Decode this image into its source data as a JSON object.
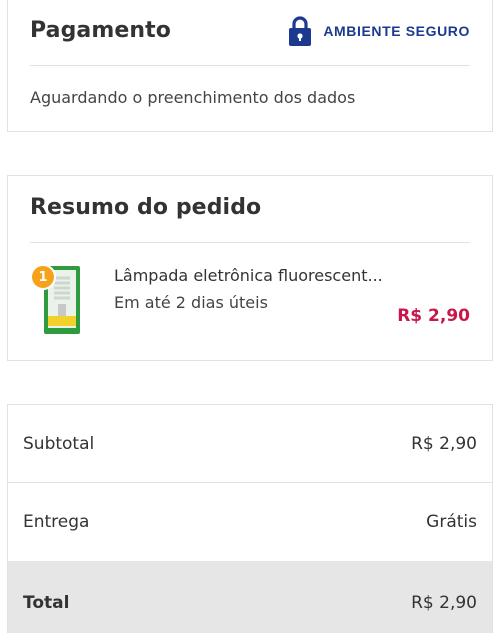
{
  "payment": {
    "title": "Pagamento",
    "secure_label": "AMBIENTE SEGURO",
    "status": "Aguardando o preenchimento dos dados"
  },
  "summary": {
    "title": "Resumo do pedido",
    "item": {
      "quantity": "1",
      "name": "Lâmpada eletrônica fluorescent...",
      "delivery": "Em até 2 dias úteis",
      "price": "R$ 2,90"
    }
  },
  "totals": {
    "subtotal_label": "Subtotal",
    "subtotal_value": "R$ 2,90",
    "delivery_label": "Entrega",
    "delivery_value": "Grátis",
    "total_label": "Total",
    "total_value": "R$ 2,90"
  },
  "colors": {
    "secure_blue": "#1b3a8f",
    "price_red": "#c8174a",
    "badge_orange": "#f6a31b"
  }
}
